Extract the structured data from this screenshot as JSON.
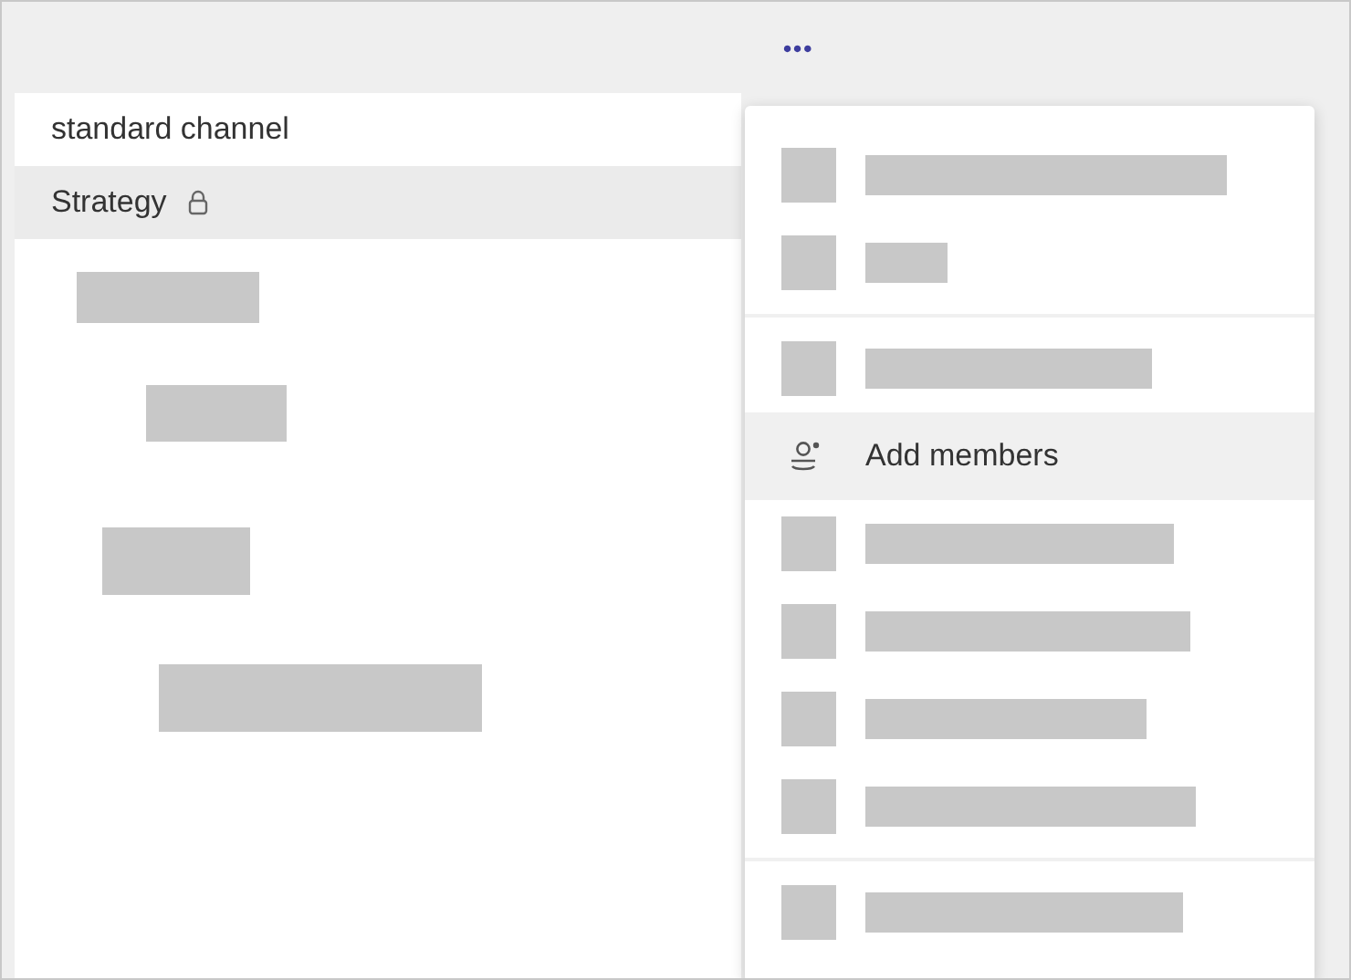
{
  "header": {
    "more_button": "•••"
  },
  "channels": [
    {
      "label": "standard channel",
      "selected": false,
      "locked": false
    },
    {
      "label": "Strategy",
      "selected": true,
      "locked": true
    }
  ],
  "menu": {
    "sections": [
      {
        "items": [
          {
            "kind": "placeholder"
          },
          {
            "kind": "placeholder"
          }
        ]
      },
      {
        "items": [
          {
            "kind": "placeholder"
          },
          {
            "kind": "action",
            "label": "Add members",
            "hovered": true
          },
          {
            "kind": "placeholder"
          },
          {
            "kind": "placeholder"
          },
          {
            "kind": "placeholder"
          },
          {
            "kind": "placeholder"
          }
        ]
      },
      {
        "items": [
          {
            "kind": "placeholder"
          }
        ]
      }
    ]
  }
}
